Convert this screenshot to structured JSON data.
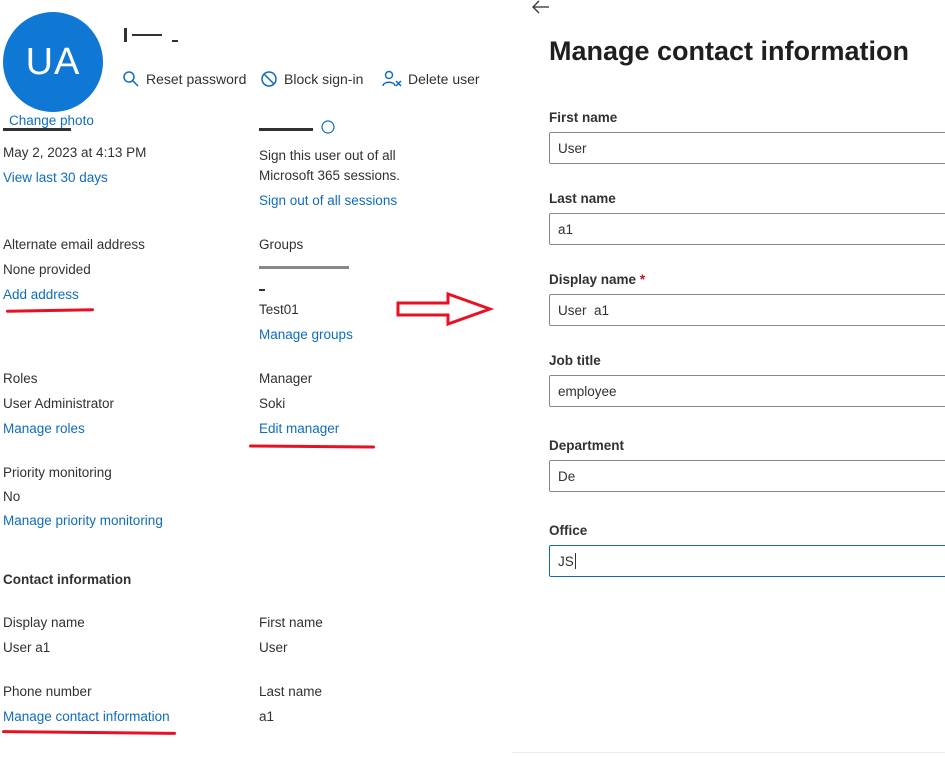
{
  "user": {
    "initials": "UA",
    "change_photo": "Change photo"
  },
  "toolbar": {
    "reset_password": "Reset password",
    "block_sign_in": "Block sign-in",
    "delete_user": "Delete user"
  },
  "last_sign_in": {
    "value": "May 2, 2023 at 4:13 PM",
    "link": "View last 30 days"
  },
  "sign_out": {
    "desc_line1": "Sign this user out of all",
    "desc_line2": "Microsoft 365 sessions.",
    "link": "Sign out of all sessions"
  },
  "alternate_email": {
    "label": "Alternate email address",
    "value": "None provided",
    "link": "Add address"
  },
  "groups": {
    "label": "Groups",
    "item2": "Test01",
    "link": "Manage groups"
  },
  "roles": {
    "label": "Roles",
    "value": "User Administrator",
    "link": "Manage roles"
  },
  "manager": {
    "label": "Manager",
    "value": "Soki",
    "link": "Edit manager"
  },
  "priority": {
    "label": "Priority monitoring",
    "value": "No",
    "link": "Manage priority monitoring"
  },
  "contact": {
    "heading": "Contact information",
    "display_name_label": "Display name",
    "display_name_value": "User a1",
    "first_name_label": "First name",
    "first_name_value": "User",
    "phone_label": "Phone number",
    "phone_link": "Manage contact information",
    "last_name_label": "Last name",
    "last_name_value": "a1"
  },
  "panel": {
    "title": "Manage contact information",
    "fields": {
      "first_name": {
        "label": "First name",
        "value": "User"
      },
      "last_name": {
        "label": "Last name",
        "value": "a1"
      },
      "display_name": {
        "label": "Display name",
        "required_mark": "*",
        "value": "User  a1"
      },
      "job_title": {
        "label": "Job title",
        "value": "employee"
      },
      "department": {
        "label": "Department",
        "value": "De"
      },
      "office": {
        "label": "Office",
        "value": "JS"
      }
    }
  },
  "colors": {
    "accent": "#0f6cbd",
    "avatar": "#0f78d4",
    "annotation": "#e81123"
  },
  "icons": [
    "search-key-icon",
    "block-icon",
    "delete-user-icon",
    "back-arrow-icon",
    "annotation-arrow-icon"
  ]
}
